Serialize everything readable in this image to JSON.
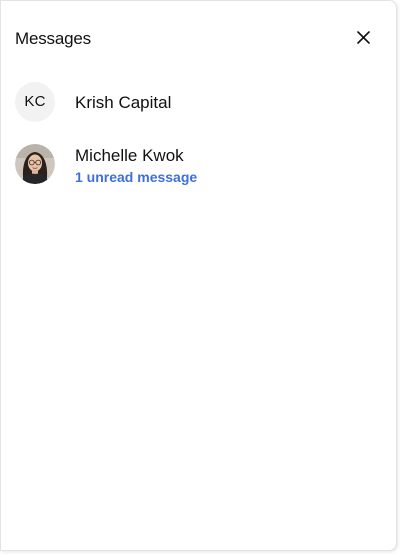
{
  "panel": {
    "title": "Messages",
    "close_icon": "close-icon"
  },
  "conversations": [
    {
      "initials": "KC",
      "name": "Krish Capital",
      "status": ""
    },
    {
      "avatar_icon": "avatar-photo",
      "name": "Michelle Kwok",
      "status": "1 unread message"
    }
  ],
  "colors": {
    "unread": "#3f6fd8",
    "avatar_bg": "#f2f2f2",
    "text": "#111111"
  }
}
